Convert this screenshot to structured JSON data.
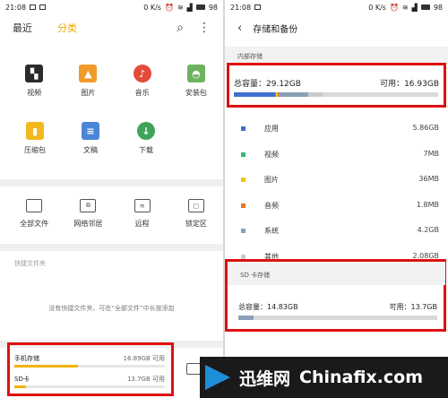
{
  "left": {
    "status": {
      "time": "21:08",
      "net": "0 K/s",
      "battery": "98"
    },
    "tabs": [
      {
        "label": "最近"
      },
      {
        "label": "分类"
      }
    ],
    "categories": [
      {
        "label": "视频",
        "icon": "video-clapper-icon",
        "color": "#2b2b2b"
      },
      {
        "label": "图片",
        "icon": "image-icon",
        "color": "#f19a2a"
      },
      {
        "label": "音乐",
        "icon": "music-note-icon",
        "color": "#e34b3b"
      },
      {
        "label": "安装包",
        "icon": "android-icon",
        "color": "#6db35f"
      },
      {
        "label": "压缩包",
        "icon": "zip-file-icon",
        "color": "#f2b81d"
      },
      {
        "label": "文稿",
        "icon": "document-icon",
        "color": "#4a86d8"
      },
      {
        "label": "下载",
        "icon": "download-icon",
        "color": "#3fa35a"
      }
    ],
    "tools": [
      {
        "label": "全部文件",
        "icon": "sd-card-icon"
      },
      {
        "label": "网络邻居",
        "icon": "network-computers-icon"
      },
      {
        "label": "远程",
        "icon": "remote-wifi-icon"
      },
      {
        "label": "锁定区",
        "icon": "lock-icon"
      }
    ],
    "quick_title": "快捷文件夹",
    "quick_empty": "没有快捷文件夹，可在“全部文件”中长按添加",
    "storage": [
      {
        "name": "手机存储",
        "value": "16.89GB 可用",
        "used_fraction": 0.42
      },
      {
        "name": "SD卡",
        "value": "13.7GB 可用",
        "used_fraction": 0.08
      }
    ]
  },
  "right": {
    "status": {
      "time": "21:08",
      "net": "0 K/s",
      "battery": "98"
    },
    "title": "存储和备份",
    "internal": {
      "header": "内部存储",
      "total_label": "总容量：29.12GB",
      "avail_label": "可用：16.93GB",
      "items": [
        {
          "name": "应用",
          "value": "5.86GB",
          "color": "#3f6fd1",
          "fraction": 0.201
        },
        {
          "name": "视频",
          "value": "7MB",
          "color": "#3cb37a",
          "fraction": 0.004
        },
        {
          "name": "图片",
          "value": "36MB",
          "color": "#f2c200",
          "fraction": 0.012
        },
        {
          "name": "音频",
          "value": "1.8MB",
          "color": "#e8732a",
          "fraction": 0.004
        },
        {
          "name": "系统",
          "value": "4.2GB",
          "color": "#8aa0b8",
          "fraction": 0.144
        },
        {
          "name": "其他",
          "value": "2.08GB",
          "color": "#c8ccd0",
          "fraction": 0.071
        }
      ]
    },
    "sd": {
      "header": "SD 卡存储",
      "total_label": "总容量：14.83GB",
      "avail_label": "可用：13.7GB",
      "used_fraction": 0.076
    }
  },
  "watermark": {
    "brand_cn": "迅维网",
    "brand_en": "Chinafix.com"
  }
}
